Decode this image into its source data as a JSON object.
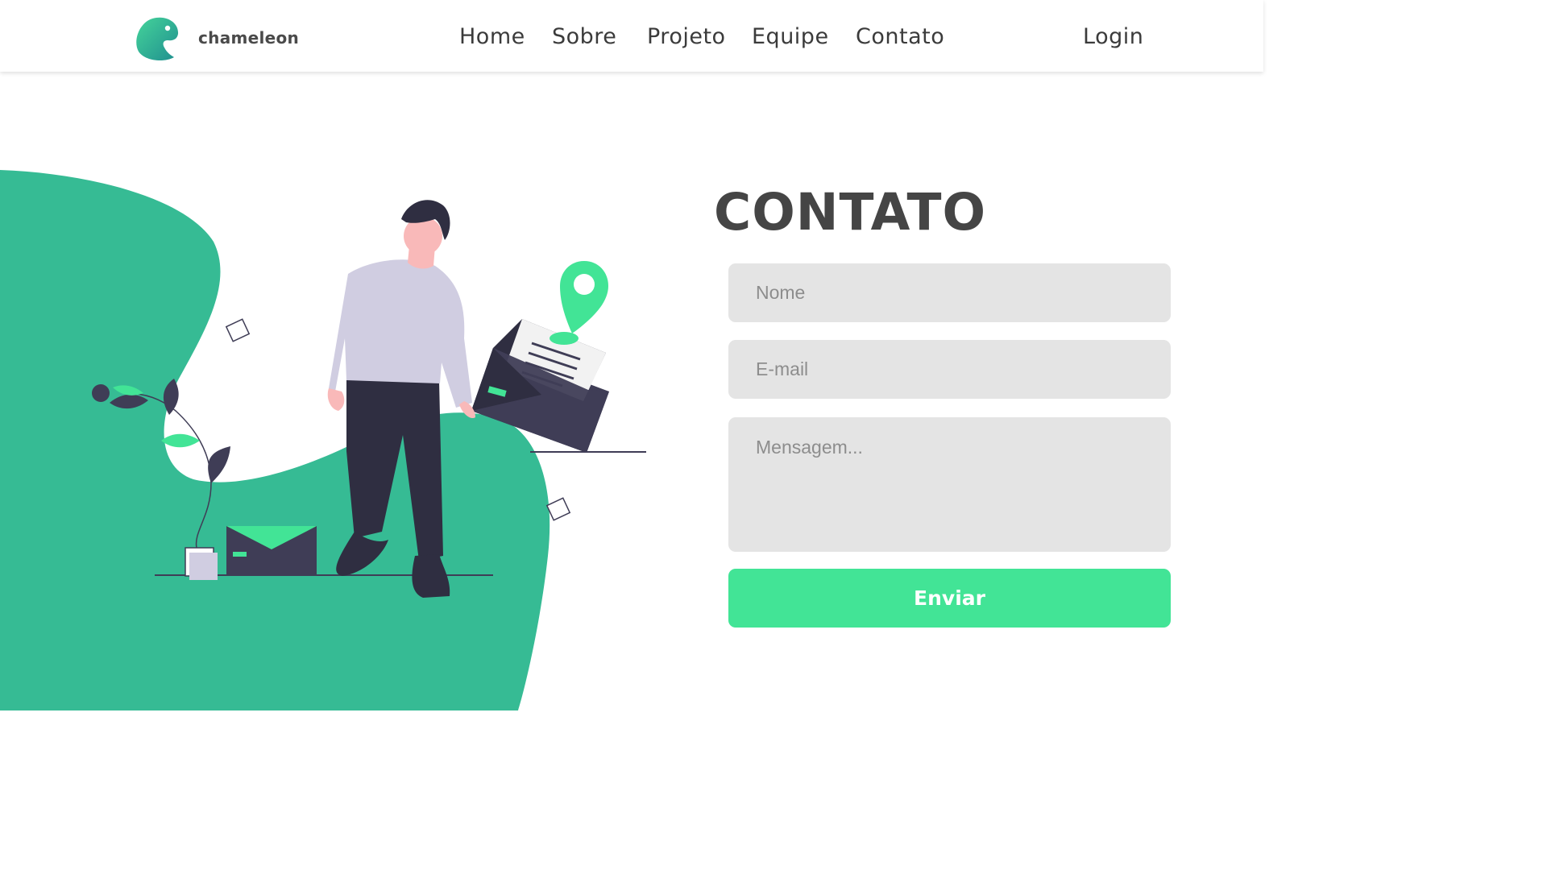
{
  "brand": {
    "name": "chameleon",
    "logo_icon": "chameleon-logo-icon"
  },
  "nav": {
    "links": [
      "Home",
      "Sobre",
      "Projeto",
      "Equipe",
      "Contato"
    ],
    "login": "Login"
  },
  "contact": {
    "title": "CONTATO",
    "name_placeholder": "Nome",
    "email_placeholder": "E-mail",
    "message_placeholder": "Mensagem...",
    "submit_label": "Enviar"
  },
  "colors": {
    "accent": "#42e496",
    "blob": "#36bb94",
    "dark": "#3f3d56",
    "text": "#454545",
    "field_bg": "#e4e4e4"
  }
}
